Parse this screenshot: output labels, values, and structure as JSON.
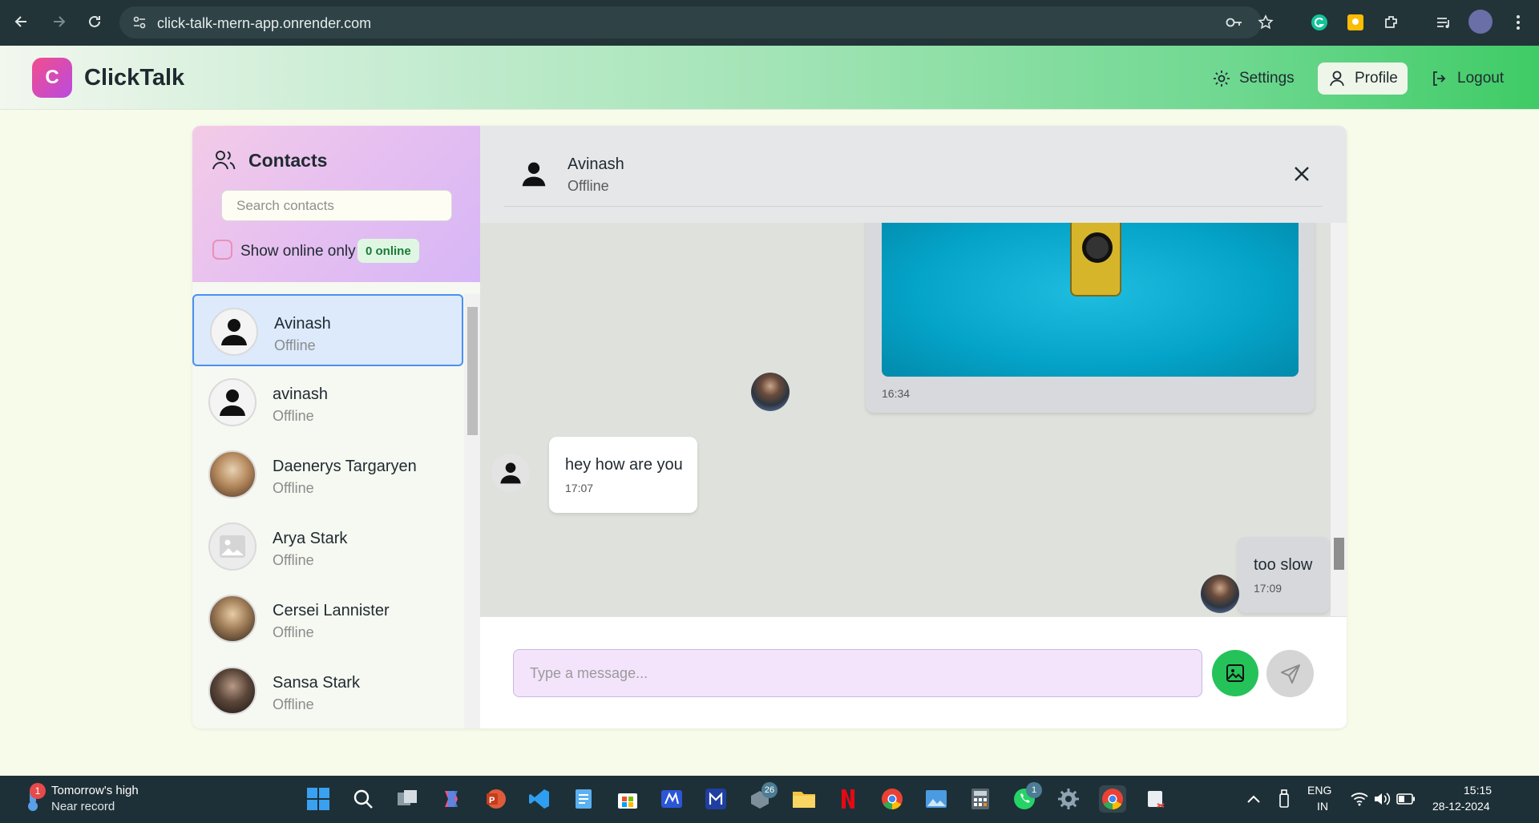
{
  "browser": {
    "url": "click-talk-mern-app.onrender.com"
  },
  "header": {
    "logo_letter": "C",
    "brand": "ClickTalk",
    "settings_label": "Settings",
    "profile_label": "Profile",
    "logout_label": "Logout"
  },
  "sidebar": {
    "title": "Contacts",
    "search_placeholder": "Search contacts",
    "online_toggle_label": "Show online only",
    "online_count": "0 online",
    "contacts": [
      {
        "name": "Avinash",
        "status": "Offline",
        "avatar": "person-icon",
        "active": true
      },
      {
        "name": "avinash",
        "status": "Offline",
        "avatar": "person-icon",
        "active": false
      },
      {
        "name": "Daenerys Targaryen",
        "status": "Offline",
        "avatar": "photo",
        "active": false
      },
      {
        "name": "Arya Stark",
        "status": "Offline",
        "avatar": "image-placeholder-icon",
        "active": false
      },
      {
        "name": "Cersei Lannister",
        "status": "Offline",
        "avatar": "photo",
        "active": false
      },
      {
        "name": "Sansa Stark",
        "status": "Offline",
        "avatar": "photo",
        "active": false
      }
    ]
  },
  "chat": {
    "contact_name": "Avinash",
    "contact_status": "Offline",
    "messages": [
      {
        "type": "image",
        "sender": "me",
        "time": "16:34"
      },
      {
        "type": "text",
        "sender": "them",
        "text": "hey how are you",
        "time": "17:07"
      },
      {
        "type": "text",
        "sender": "me",
        "text": "too slow",
        "time": "17:09"
      }
    ],
    "input_placeholder": "Type a message..."
  },
  "taskbar": {
    "weather_title": "Tomorrow's high",
    "weather_subtitle": "Near record",
    "weather_badge": "1",
    "files_badge": "26",
    "whatsapp_badge": "1",
    "lang_top": "ENG",
    "lang_bottom": "IN",
    "time": "15:15",
    "date": "28-12-2024"
  },
  "colors": {
    "accent_green": "#25c25a",
    "active_contact": "#dceafc",
    "brand_pink": "#f24d8c"
  }
}
